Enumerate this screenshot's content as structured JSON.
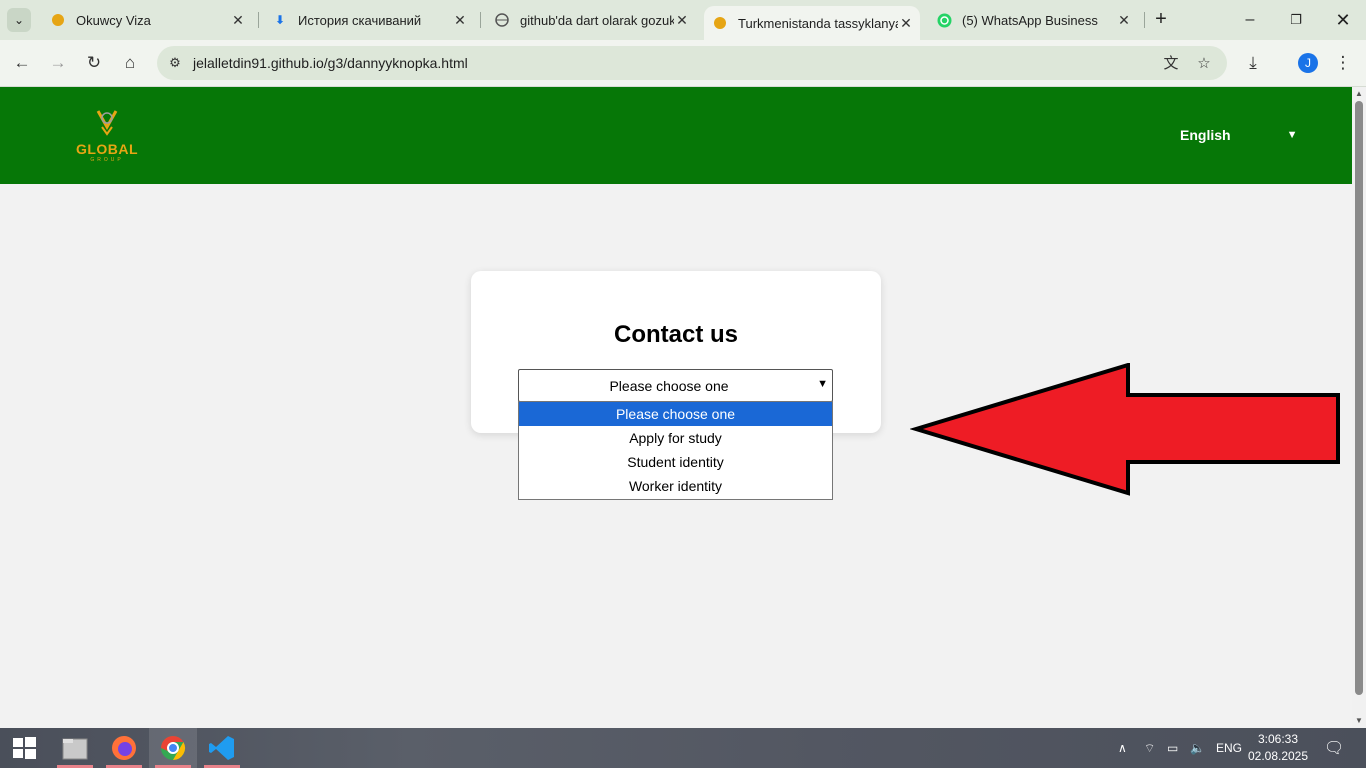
{
  "browser": {
    "tabs": [
      {
        "title": "Okuwcy Viza",
        "icon": "global-logo-favicon",
        "active": false
      },
      {
        "title": "История скачиваний",
        "icon": "download-icon",
        "active": false
      },
      {
        "title": "github'da dart olarak gozuk",
        "icon": "globe-icon",
        "active": false
      },
      {
        "title": "Turkmenistanda tassyklanya",
        "icon": "global-logo-favicon",
        "active": true
      },
      {
        "title": "(5) WhatsApp Business",
        "icon": "whatsapp-icon",
        "active": false
      }
    ],
    "url": "jelalletdin91.github.io/g3/dannyyknopka.html",
    "profile_initial": "J"
  },
  "site": {
    "logo_text": "GLOBAL",
    "logo_sub": "GROUP",
    "language": "English",
    "brand_color": "#067707",
    "accent_color": "#e6a514"
  },
  "contact": {
    "title": "Contact us",
    "select_value": "Please choose one",
    "options": [
      "Please choose one",
      "Apply for study",
      "Student identity",
      "Worker identity"
    ],
    "highlighted_option": "Please choose one"
  },
  "annotation": {
    "arrow_color": "#ee1c25",
    "arrow_direction": "left"
  },
  "taskbar": {
    "apps": [
      "file-explorer-icon",
      "firefox-icon",
      "chrome-icon",
      "vscode-icon"
    ],
    "language": "ENG",
    "time": "3:06:33",
    "date": "02.08.2025"
  }
}
